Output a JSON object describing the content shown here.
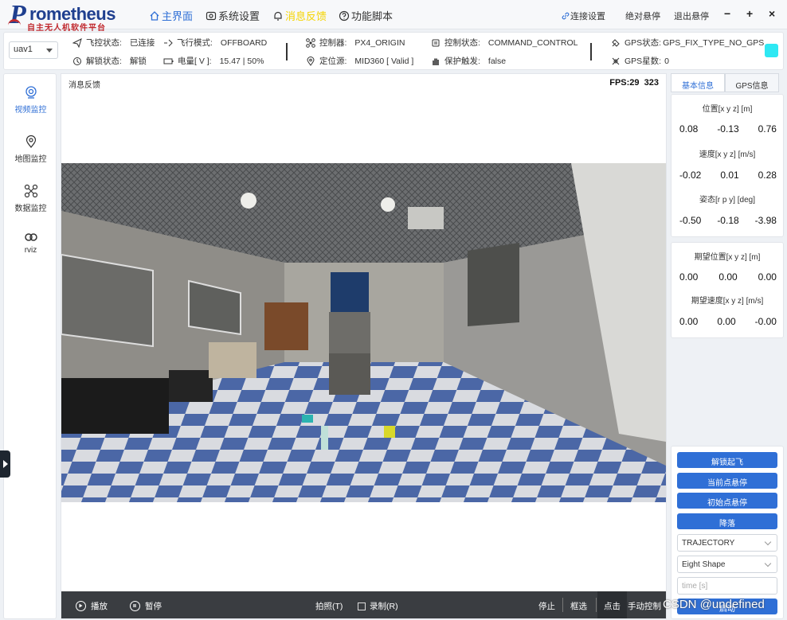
{
  "app": {
    "logo_text": "rometheus",
    "logo_letter": "P",
    "logo_subtitle": "自主无人机软件平台"
  },
  "nav": {
    "home": "主界面",
    "settings": "系统设置",
    "feedback": "消息反馈",
    "scripts": "功能脚本"
  },
  "top_right": {
    "connect": "连接设置",
    "abs_hover": "绝对悬停",
    "exit_hover": "退出悬停",
    "minimize": "−",
    "maximize": "+",
    "close": "×"
  },
  "status": {
    "uav_select": "uav1",
    "fc_state_label": "飞控状态:",
    "fc_state_value": "已连接",
    "arm_label": "解锁状态:",
    "arm_value": "解锁",
    "mode_label": "飞行模式:",
    "mode_value": "OFFBOARD",
    "battery_label": "电量[ V ]:",
    "battery_value": "15.47 | 50%",
    "controller_label": "控制器:",
    "controller_value": "PX4_ORIGIN",
    "loc_label": "定位源:",
    "loc_value": "MID360 [ Valid ]",
    "ctrl_state_label": "控制状态:",
    "ctrl_state_value": "COMMAND_CONTROL",
    "protect_label": "保护触发:",
    "protect_value": "false",
    "gps_state_label": "GPS状态:",
    "gps_state_value": "GPS_FIX_TYPE_NO_GPS",
    "gps_sats_label": "GPS星数:",
    "gps_sats_value": "0",
    "indicator_color": "#2ee8f3"
  },
  "sidebar": {
    "items": [
      {
        "label": "视频监控",
        "icon": "camera-icon"
      },
      {
        "label": "地图监控",
        "icon": "map-pin-icon"
      },
      {
        "label": "数据监控",
        "icon": "drone-icon"
      },
      {
        "label": "rviz",
        "icon": "rviz-icon"
      }
    ]
  },
  "main": {
    "msg_label": "消息反馈",
    "fps_label": "FPS:29",
    "fps_extra": "323"
  },
  "controls": {
    "play": "播放",
    "pause": "暂停",
    "snapshot": "拍照(T)",
    "record": "录制(R)",
    "stop": "停止",
    "box_select": "框选",
    "click_point": "点击",
    "manual": "手动控制"
  },
  "right": {
    "tab_basic": "基本信息",
    "tab_gps": "GPS信息",
    "pos_label": "位置[x y z] [m]",
    "pos": [
      "0.08",
      "-0.13",
      "0.76"
    ],
    "vel_label": "速度[x y z] [m/s]",
    "vel": [
      "-0.02",
      "0.01",
      "0.28"
    ],
    "att_label": "姿态[r p y] [deg]",
    "att": [
      "-0.50",
      "-0.18",
      "-3.98"
    ],
    "des_pos_label": "期望位置[x y z] [m]",
    "des_pos": [
      "0.00",
      "0.00",
      "0.00"
    ],
    "des_vel_label": "期望速度[x y z] [m/s]",
    "des_vel": [
      "0.00",
      "0.00",
      "-0.00"
    ]
  },
  "actions": {
    "takeoff": "解锁起飞",
    "hover_current": "当前点悬停",
    "hover_initial": "初始点悬停",
    "land": "降落",
    "traj_select": "TRAJECTORY",
    "shape_select": "Eight Shape",
    "time_placeholder": "time [s]",
    "start": "启动"
  },
  "watermark": "CSDN @undefined"
}
